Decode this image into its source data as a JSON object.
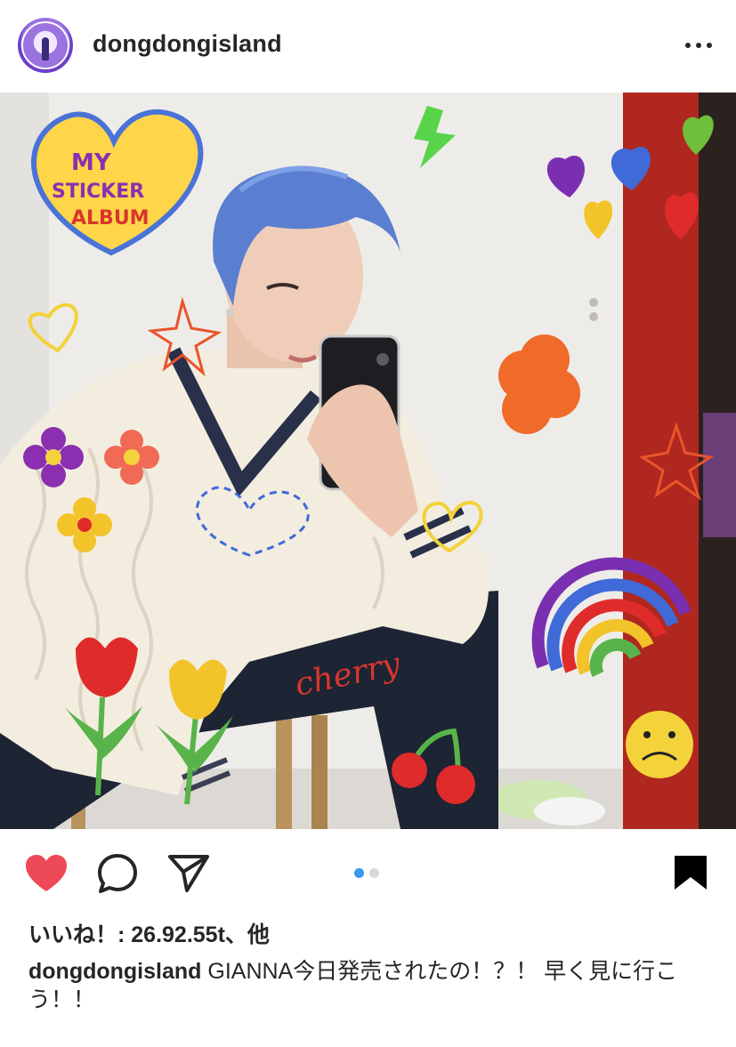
{
  "post": {
    "username": "dongdongisland",
    "likes_text": "いいね！: 26.92.55t、他",
    "caption_text": "GIANNA今日発売されたの！？！ 早く見に行こう！！",
    "carousel": {
      "count": 2,
      "active_index": 0
    }
  },
  "photo": {
    "sticker_heart_text": [
      "MY",
      "STICKER",
      "ALBUM"
    ],
    "doodle_word": "cherry"
  },
  "icons": {
    "avatar": "profile-avatar",
    "more": "more-options-icon",
    "like": "heart-icon",
    "comment": "comment-icon",
    "share": "paper-plane-icon",
    "save": "bookmark-icon"
  },
  "colors": {
    "like_red": "#ed4956",
    "dot_active": "#3897f0",
    "dot_inactive": "#d8d8d8",
    "text": "#262626"
  }
}
